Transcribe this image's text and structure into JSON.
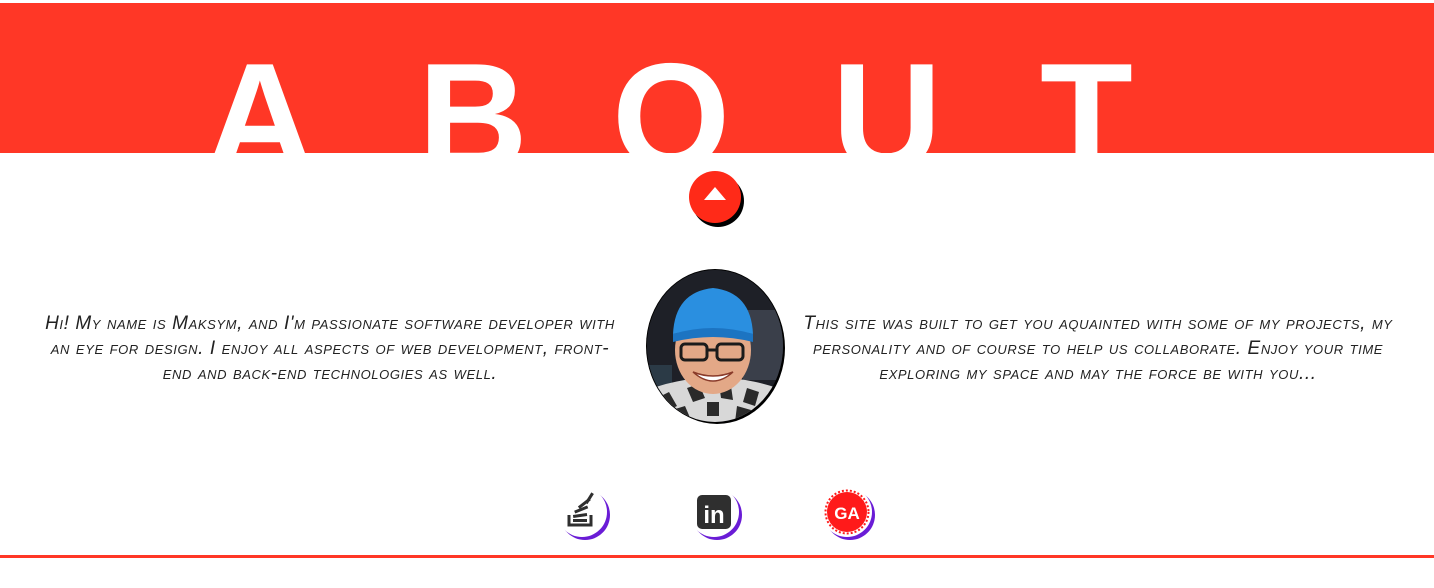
{
  "hero": {
    "letters": [
      "A",
      "B",
      "O",
      "U",
      "T"
    ],
    "background_color": "#ff3726"
  },
  "scroll_up": {
    "icon": "arrow-up-icon",
    "color": "#ff2a18"
  },
  "about": {
    "left_text": "Hi! My name is Maksym, and I'm passionate software developer with an eye for design. I enjoy all aspects of web development, front-end and back-end technologies as well.",
    "right_text": "This site was built to get you aquainted with some of my projects, my personality and of course to help us collaborate. Enjoy your time exploring my space and may the force be with you..."
  },
  "avatar": {
    "icon": "profile-photo"
  },
  "social": [
    {
      "icon": "stack-overflow-icon",
      "brand_color": "#2f2f2f"
    },
    {
      "icon": "linkedin-icon",
      "label": "in",
      "brand_color": "#2f2f2f"
    },
    {
      "icon": "general-assembly-icon",
      "label": "GA",
      "brand_color": "#ff1a1a"
    }
  ],
  "accent_color": "#ff3726"
}
